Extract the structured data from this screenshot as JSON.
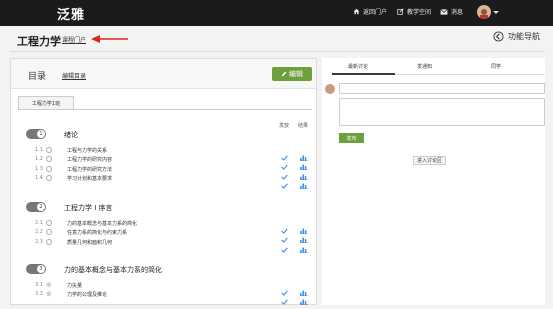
{
  "topbar": {
    "logo": "泛雅",
    "nav": [
      {
        "label": "返回门户",
        "icon": "home-icon"
      },
      {
        "label": "教学空间",
        "icon": "edit-icon"
      },
      {
        "label": "消息",
        "icon": "mail-icon"
      }
    ]
  },
  "header": {
    "course_title": "工程力学",
    "portal_link": "课程门户",
    "func_nav": "功能导航"
  },
  "toc": {
    "title": "目录",
    "edit_toc": "编辑目录",
    "edit_button": "编辑",
    "class_tab": "工程力学1班",
    "col_release": "发放",
    "col_result": "结果",
    "chapters": [
      {
        "number": "1",
        "title": "绪论",
        "sections": [
          {
            "num": "1.1",
            "label": "工程与力学的关系"
          },
          {
            "num": "1.2",
            "label": "工程力学的研究内容"
          },
          {
            "num": "1.3",
            "label": "工程力学的研究方法"
          },
          {
            "num": "1.4",
            "label": "学习计划和基本要求"
          }
        ]
      },
      {
        "number": "2",
        "title": "工程力学 I 序言",
        "sections": [
          {
            "num": "2.1",
            "label": "力的基本概念与基本力系的简化"
          },
          {
            "num": "2.2",
            "label": "任意力系的简化与约束力系"
          },
          {
            "num": "2.3",
            "label": "质量几何和面积几何"
          }
        ]
      },
      {
        "number": "3",
        "title": "力的基本概念与基本力系的简化",
        "sections": [
          {
            "num": "3.1",
            "label": "力矢量"
          },
          {
            "num": "3.2",
            "label": "力学的公理及推论"
          }
        ]
      }
    ]
  },
  "discussion": {
    "tabs": [
      "最新讨论",
      "发通知",
      "同学"
    ],
    "post_button": "发布",
    "forum_button": "进入讨论区"
  },
  "colors": {
    "topbar": "#1b1b1b",
    "accent_green": "#6d9f3d",
    "check_blue": "#3a8ee6",
    "arrow_red": "#d9261c"
  }
}
